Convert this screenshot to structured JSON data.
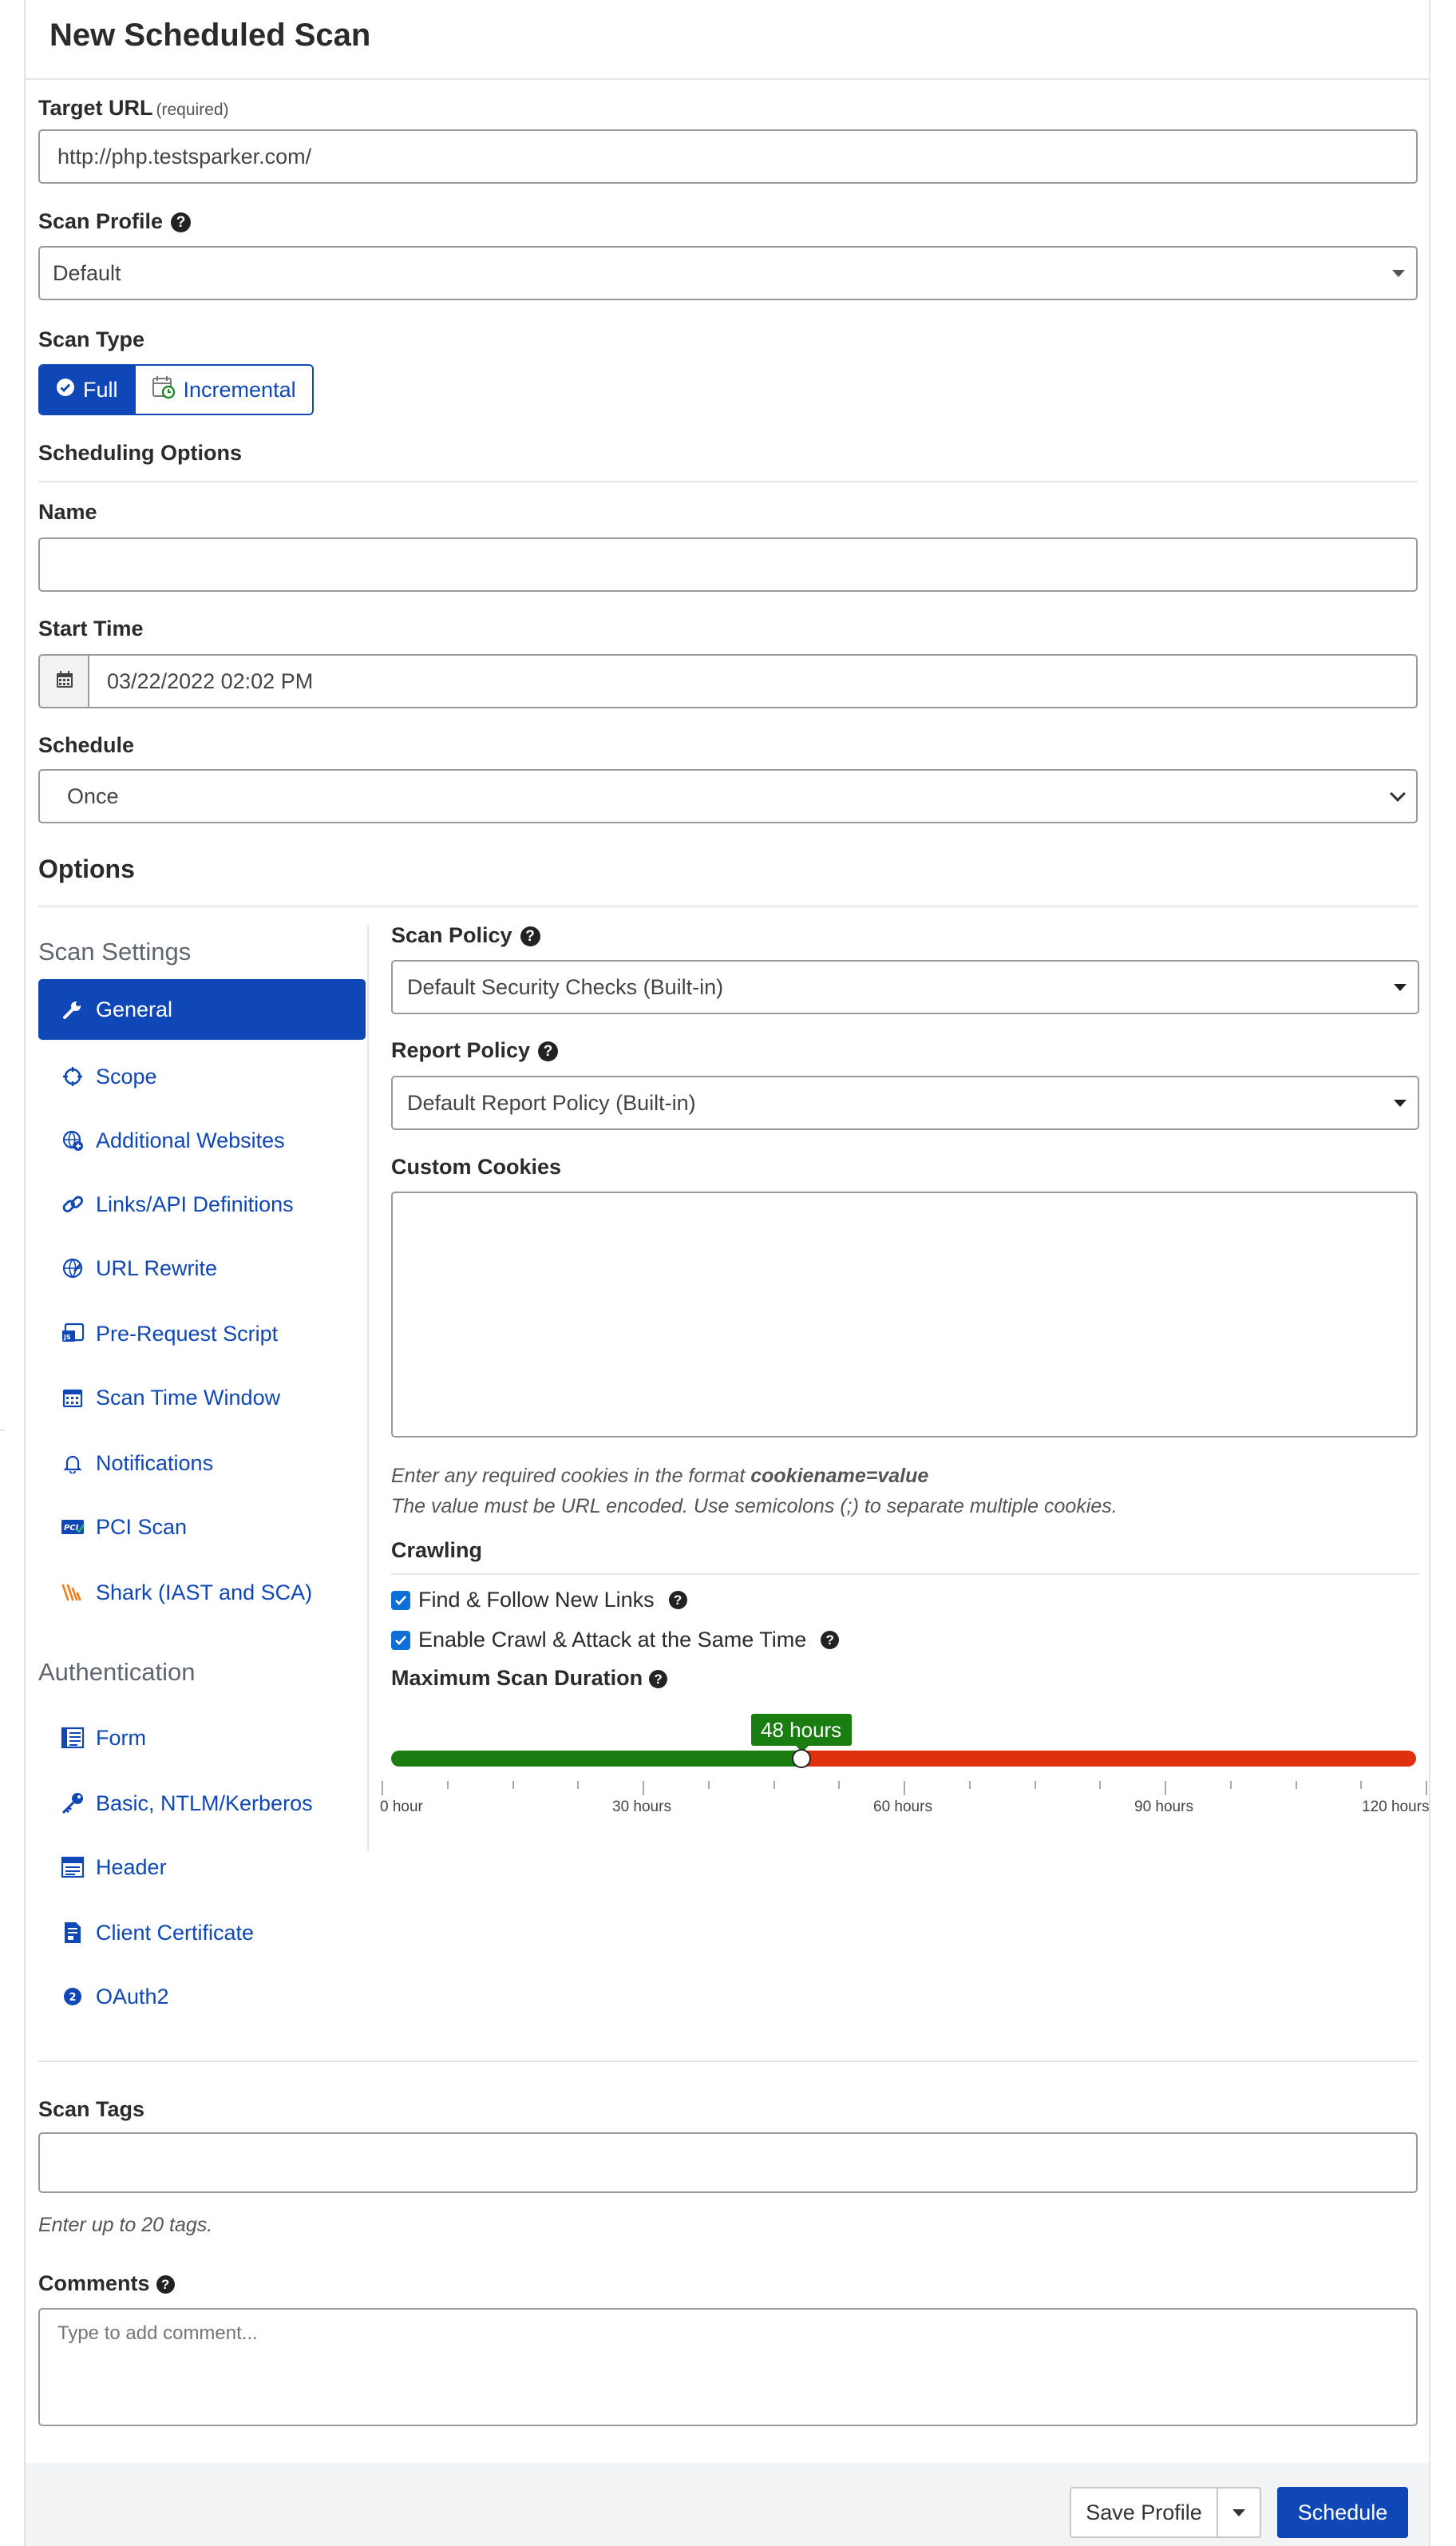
{
  "page": {
    "title": "New Scheduled Scan"
  },
  "target_url": {
    "label": "Target URL",
    "required_hint": "(required)",
    "value": "http://php.testsparker.com/"
  },
  "scan_profile": {
    "label": "Scan Profile",
    "value": "Default"
  },
  "scan_type": {
    "label": "Scan Type",
    "options": [
      "Full",
      "Incremental"
    ],
    "selected": "Full"
  },
  "scheduling": {
    "section_title": "Scheduling Options",
    "name_label": "Name",
    "name_value": "",
    "start_time_label": "Start Time",
    "start_time_value": "03/22/2022 02:02 PM",
    "schedule_label": "Schedule",
    "schedule_value": "Once"
  },
  "options": {
    "title": "Options"
  },
  "sidebar": {
    "scan_settings_heading": "Scan Settings",
    "scan_settings_items": [
      {
        "label": "General",
        "icon": "wrench-icon",
        "active": true
      },
      {
        "label": "Scope",
        "icon": "crosshair-icon"
      },
      {
        "label": "Additional Websites",
        "icon": "globe-plus-icon"
      },
      {
        "label": "Links/API Definitions",
        "icon": "link-icon"
      },
      {
        "label": "URL Rewrite",
        "icon": "globe-rewrite-icon"
      },
      {
        "label": "Pre-Request Script",
        "icon": "script-icon"
      },
      {
        "label": "Scan Time Window",
        "icon": "calendar-icon"
      },
      {
        "label": "Notifications",
        "icon": "bell-icon"
      },
      {
        "label": "PCI Scan",
        "icon": "pci-icon"
      },
      {
        "label": "Shark (IAST and SCA)",
        "icon": "shark-icon"
      }
    ],
    "authentication_heading": "Authentication",
    "authentication_items": [
      {
        "label": "Form",
        "icon": "form-icon"
      },
      {
        "label": "Basic, NTLM/Kerberos",
        "icon": "key-icon"
      },
      {
        "label": "Header",
        "icon": "header-icon"
      },
      {
        "label": "Client Certificate",
        "icon": "certificate-icon"
      },
      {
        "label": "OAuth2",
        "icon": "oauth-icon"
      }
    ]
  },
  "general": {
    "scan_policy_label": "Scan Policy",
    "scan_policy_value": "Default Security Checks (Built-in)",
    "report_policy_label": "Report Policy",
    "report_policy_value": "Default Report Policy (Built-in)",
    "custom_cookies_label": "Custom Cookies",
    "custom_cookies_value": "",
    "cookies_hint_prefix": "Enter any required cookies in the format ",
    "cookies_hint_format": "cookiename=value",
    "cookies_hint_line2": "The value must be URL encoded. Use semicolons (;) to separate multiple cookies.",
    "crawling_label": "Crawling",
    "find_follow_label": "Find & Follow New Links",
    "find_follow_checked": true,
    "crawl_attack_label": "Enable Crawl & Attack at the Same Time",
    "crawl_attack_checked": true,
    "max_duration_label": "Maximum Scan Duration",
    "max_duration_value_label": "48 hours",
    "max_duration_hours": 48,
    "max_duration_range": [
      0,
      120
    ],
    "tick_labels": [
      "0 hour",
      "30 hours",
      "60 hours",
      "90 hours",
      "120 hours"
    ],
    "colors": {
      "filled": "#1a7d12",
      "remaining": "#e0310f"
    }
  },
  "tags": {
    "label": "Scan Tags",
    "value": "",
    "hint": "Enter up to 20 tags."
  },
  "comments": {
    "label": "Comments",
    "placeholder": "Type to add comment..."
  },
  "footer": {
    "save_profile_label": "Save Profile",
    "schedule_label": "Schedule"
  },
  "colors": {
    "primary": "#0f47b6",
    "border": "#9a9a9a"
  }
}
